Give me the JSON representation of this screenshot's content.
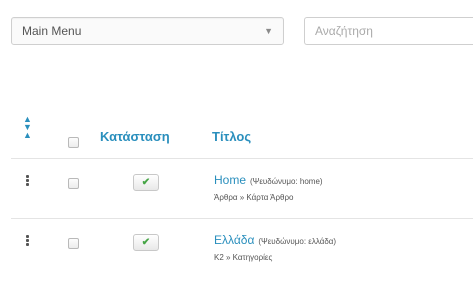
{
  "menu_select": {
    "value": "Main Menu"
  },
  "search": {
    "placeholder": "Αναζήτηση"
  },
  "table": {
    "columns": {
      "status": "Κατάσταση",
      "title": "Τίτλος"
    },
    "rows": [
      {
        "title": "Home",
        "alias": "(Ψευδώνυμο: home)",
        "meta": "Άρθρα » Κάρτα Άρθρο",
        "status": "published"
      },
      {
        "title": "Ελλάδα",
        "alias": "(Ψευδώνυμο: ελλάδα)",
        "meta": "K2 » Κατηγορίες",
        "status": "published"
      }
    ]
  },
  "icons": {
    "sort": "sort-icon",
    "drag": "drag-handle-icon",
    "published": "check-icon",
    "dropdown": "chevron-down-icon"
  },
  "colors": {
    "accent": "#2a8fbd",
    "published": "#46a546"
  }
}
